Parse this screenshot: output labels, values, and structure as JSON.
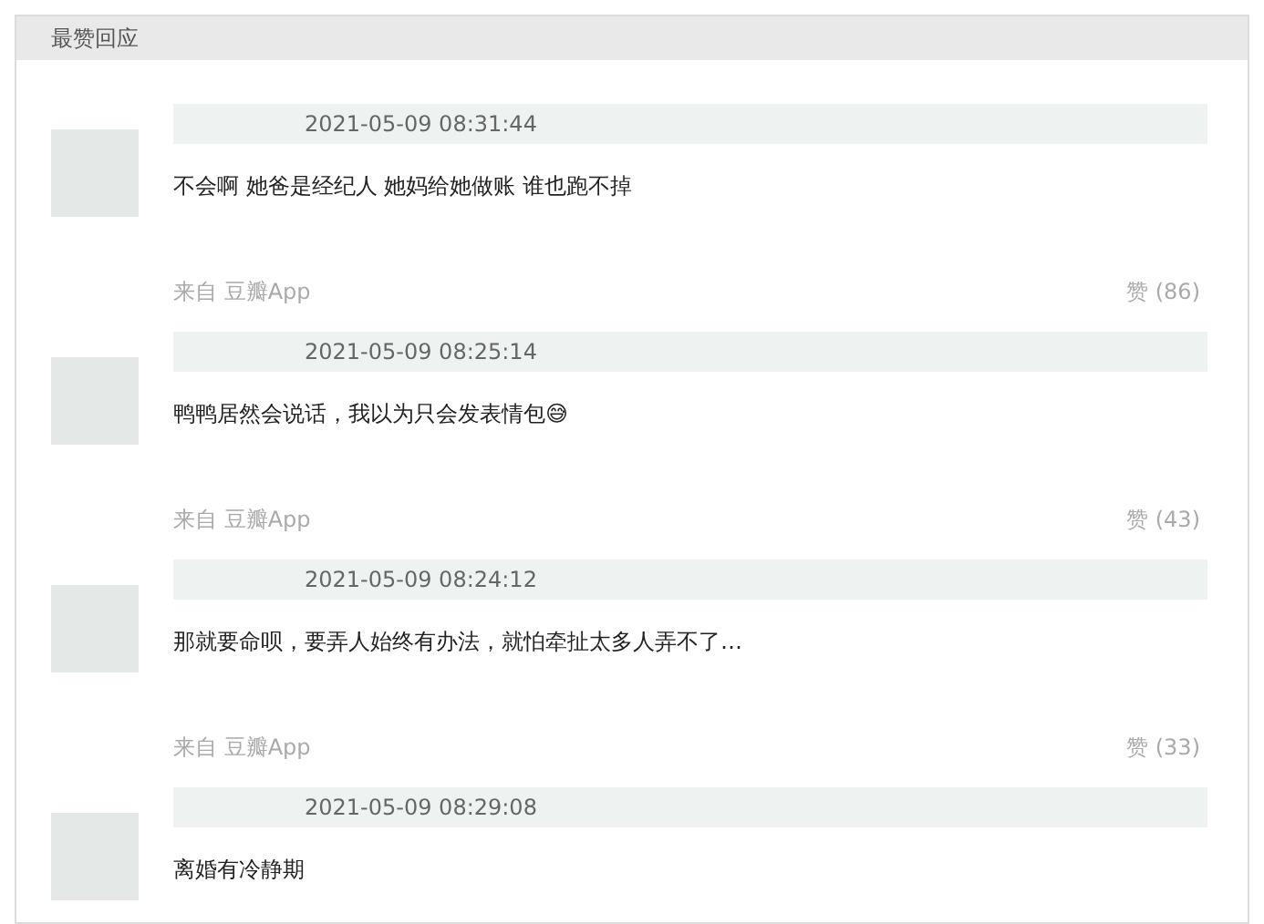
{
  "header": {
    "title": "最赞回应"
  },
  "comments": [
    {
      "time": "2021-05-09 08:31:44",
      "text": "不会啊 她爸是经纪人 她妈给她做账 谁也跑不掉",
      "source": "来自 豆瓣App",
      "likes": "赞 (86)"
    },
    {
      "time": "2021-05-09 08:25:14",
      "text": "鸭鸭居然会说话，我以为只会发表情包😅",
      "source": "来自 豆瓣App",
      "likes": "赞 (43)"
    },
    {
      "time": "2021-05-09 08:24:12",
      "text": "那就要命呗，要弄人始终有办法，就怕牵扯太多人弄不了…",
      "source": "来自 豆瓣App",
      "likes": "赞 (33)"
    },
    {
      "time": "2021-05-09 08:29:08",
      "text": "离婚有冷静期"
    }
  ]
}
